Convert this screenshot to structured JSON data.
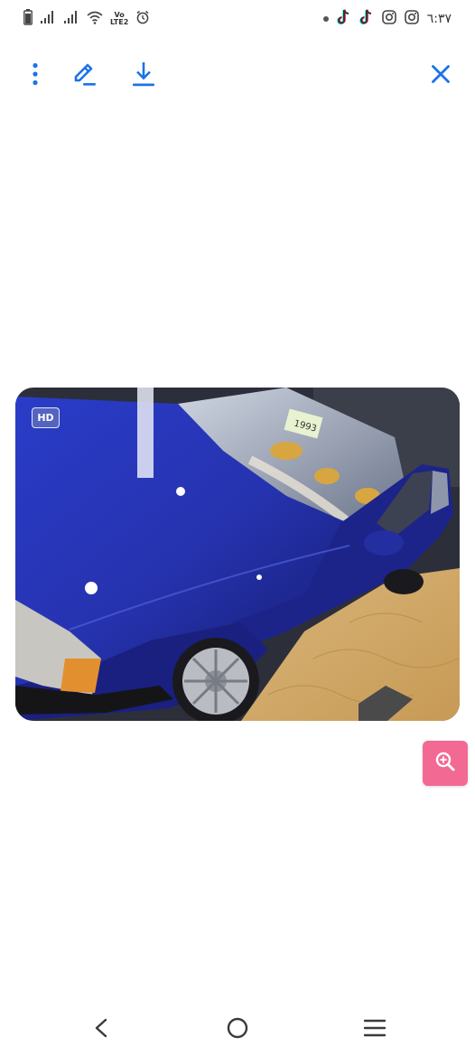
{
  "status_bar": {
    "volte_label": "Vo",
    "volte_sub": "LTE2",
    "time": "٦:٣٧",
    "icons": [
      "battery-icon",
      "signal-icon",
      "signal-icon",
      "wifi-icon",
      "volte-icon",
      "alarm-icon",
      "notification-dot",
      "tiktok-icon",
      "tiktok-icon",
      "instagram-icon",
      "instagram-icon"
    ]
  },
  "toolbar": {
    "icons": [
      "more-vert-icon",
      "edit-icon",
      "download-icon",
      "close-icon"
    ],
    "accent": "#1a73e8"
  },
  "photo": {
    "hd_label": "HD",
    "plate_text": "1993"
  },
  "zoom_button": {
    "icon": "zoom-in-icon",
    "color": "#f26a93"
  },
  "nav_bar": {
    "icons": [
      "back-icon",
      "home-icon",
      "recents-icon"
    ]
  }
}
